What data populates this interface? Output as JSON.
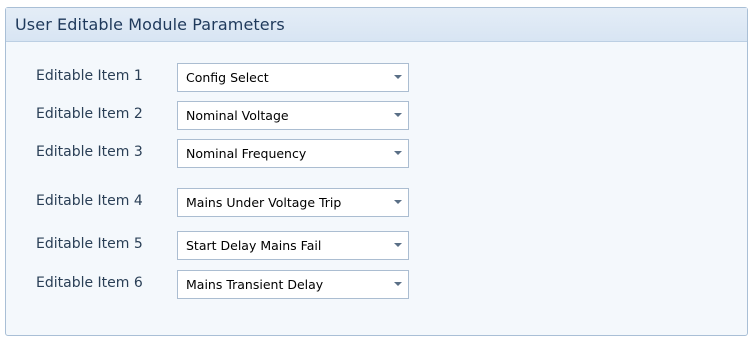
{
  "panel": {
    "title": "User Editable Module Parameters"
  },
  "items": [
    {
      "label": "Editable Item 1",
      "value": "Config Select"
    },
    {
      "label": "Editable Item 2",
      "value": "Nominal Voltage"
    },
    {
      "label": "Editable Item 3",
      "value": "Nominal Frequency"
    },
    {
      "label": "Editable Item 4",
      "value": "Mains Under Voltage Trip"
    },
    {
      "label": "Editable Item 5",
      "value": "Start Delay Mains Fail"
    },
    {
      "label": "Editable Item 6",
      "value": "Mains Transient Delay"
    }
  ],
  "icons": {
    "dropdown": "chevron-down-icon"
  }
}
